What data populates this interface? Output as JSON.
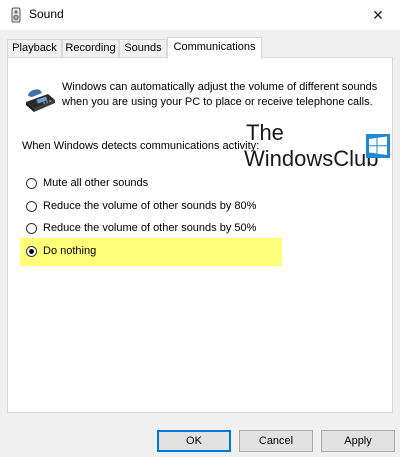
{
  "window": {
    "title": "Sound",
    "close_symbol": "✕"
  },
  "tabs": [
    {
      "label": "Playback",
      "active": false
    },
    {
      "label": "Recording",
      "active": false
    },
    {
      "label": "Sounds",
      "active": false
    },
    {
      "label": "Communications",
      "active": true
    }
  ],
  "communications": {
    "description": "Windows can automatically adjust the volume of different sounds when you are using your PC to place or receive telephone calls.",
    "detect_label": "When Windows detects communications activity:",
    "options": [
      {
        "label": "Mute all other sounds",
        "checked": false
      },
      {
        "label": "Reduce the volume of other sounds by 80%",
        "checked": false
      },
      {
        "label": "Reduce the volume of other sounds by 50%",
        "checked": false
      },
      {
        "label": "Do nothing",
        "checked": true
      }
    ],
    "highlight_color": "#ffff7a"
  },
  "watermark": {
    "line1": "The",
    "line2": "WindowsClub",
    "logo_color": "#1e88d6"
  },
  "buttons": {
    "ok": "OK",
    "cancel": "Cancel",
    "apply": "Apply"
  },
  "icons": {
    "app": "speaker-icon",
    "close": "close-icon",
    "phone": "telephone-icon"
  }
}
